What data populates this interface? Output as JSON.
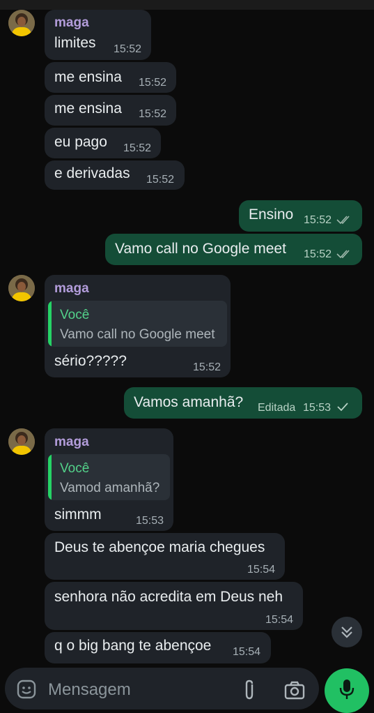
{
  "contact": {
    "name": "maga"
  },
  "reply_author": "Você",
  "messages": [
    {
      "dir": "in",
      "text": "limites",
      "time": "15:52"
    },
    {
      "dir": "in",
      "text": "me ensina",
      "time": "15:52"
    },
    {
      "dir": "in",
      "text": "me ensina",
      "time": "15:52"
    },
    {
      "dir": "in",
      "text": "eu pago",
      "time": "15:52"
    },
    {
      "dir": "in",
      "text": "e derivadas",
      "time": "15:52"
    },
    {
      "dir": "out",
      "text": "Ensino",
      "time": "15:52",
      "status": "read"
    },
    {
      "dir": "out",
      "text": "Vamo call no Google meet",
      "time": "15:52",
      "status": "read"
    },
    {
      "dir": "in",
      "quote": "Vamo call no Google meet",
      "text": "sério?????",
      "time": "15:52"
    },
    {
      "dir": "out",
      "text": "Vamos amanhã?",
      "edited": "Editada",
      "time": "15:53",
      "status": "delivered"
    },
    {
      "dir": "in",
      "quote": "Vamod amanhã?",
      "text": "simmm",
      "time": "15:53"
    },
    {
      "dir": "in",
      "text": "Deus te abençoe maria chegues",
      "time": "15:54"
    },
    {
      "dir": "in",
      "text": "senhora não acredita em Deus neh",
      "time": "15:54"
    },
    {
      "dir": "in",
      "text": "q o big bang te abençoe",
      "time": "15:54"
    }
  ],
  "composer": {
    "placeholder": "Mensagem"
  },
  "icons": {
    "emoji": "sticker-smile-icon",
    "attach": "paperclip-icon",
    "camera": "camera-icon",
    "mic": "microphone-icon",
    "scroll": "double-chevron-down-icon",
    "read_ticks": "double-check-icon",
    "sent_tick": "check-icon"
  },
  "colors": {
    "background": "#0b0b0b",
    "incoming_bubble": "#1f2329",
    "outgoing_bubble": "#144d37",
    "sender_name": "#b39ddb",
    "quote_accent": "#25d366",
    "mic_button": "#21c063"
  }
}
